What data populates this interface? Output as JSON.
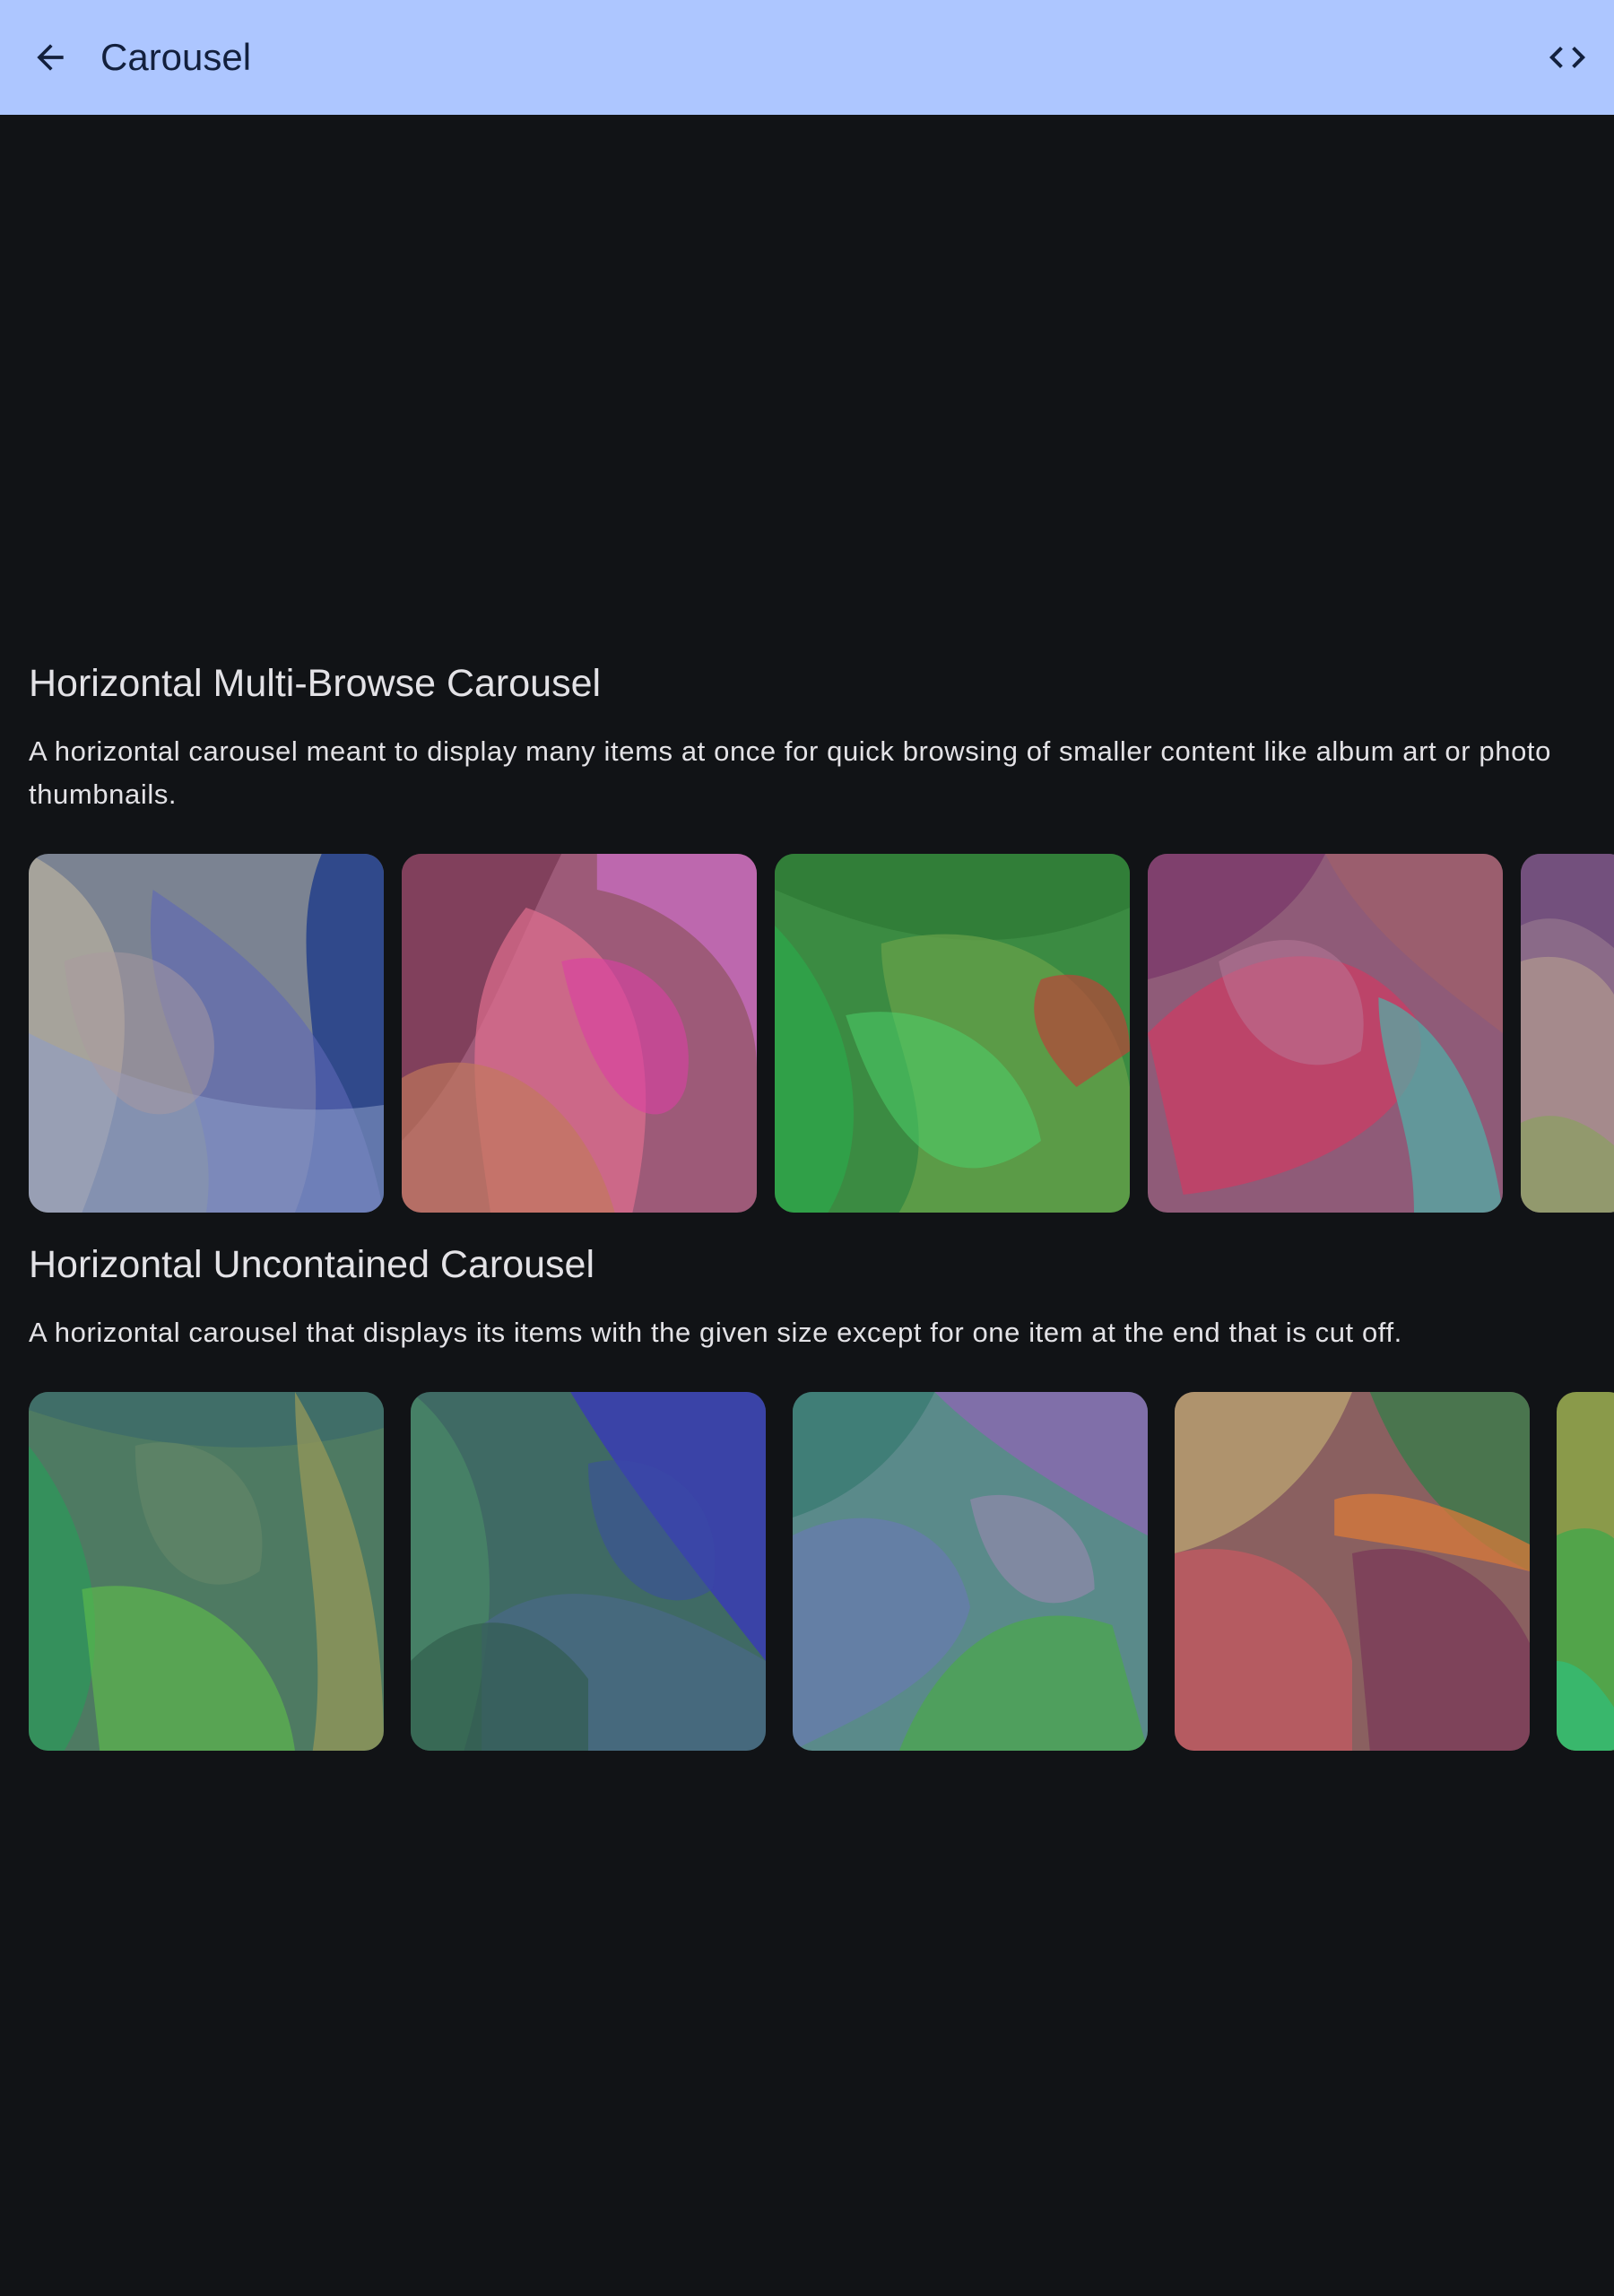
{
  "app_bar": {
    "title": "Carousel",
    "back_icon": "arrow-back-icon",
    "code_icon": "code-icon",
    "background": "#adc6ff"
  },
  "sections": [
    {
      "title": "Horizontal Multi-Browse Carousel",
      "description": "A horizontal carousel meant to display many items at once for quick browsing of smaller content like album art or photo thumbnails.",
      "item_count": 5
    },
    {
      "title": "Horizontal Uncontained Carousel",
      "description": "A horizontal carousel that displays its items with the given size except for one item at the end that is cut off.",
      "item_count": 5
    }
  ],
  "colors": {
    "background": "#111316",
    "text": "#e3e2e6"
  }
}
